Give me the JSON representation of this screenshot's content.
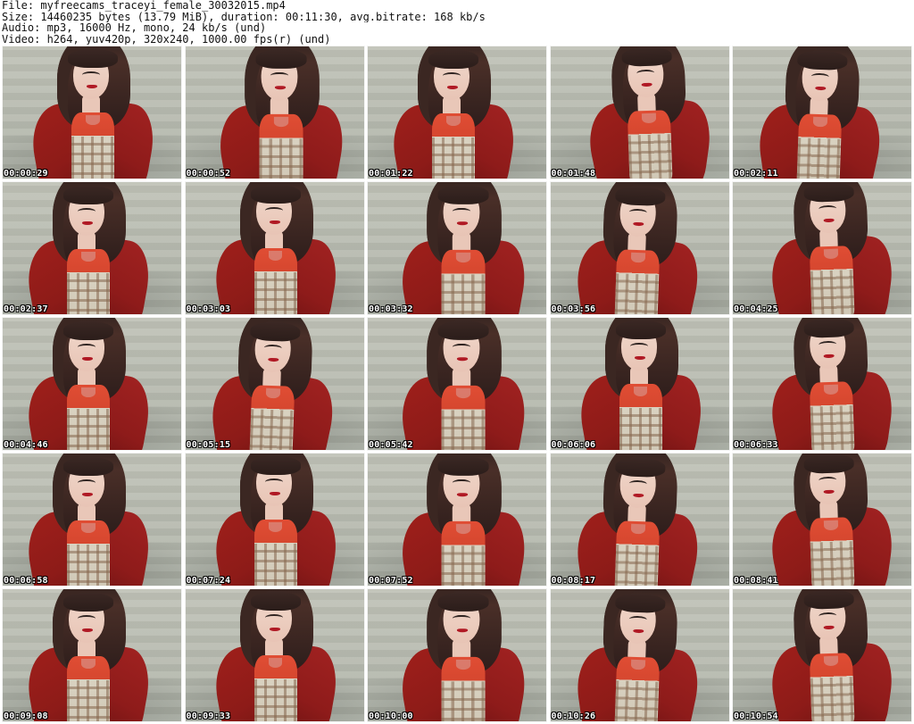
{
  "header": {
    "file": "File: myfreecams_traceyi_female_30032015.mp4",
    "size": "Size: 14460235 bytes (13.79 MiB), duration: 00:11:30, avg.bitrate: 168 kb/s",
    "audio": "Audio: mp3, 16000 Hz, mono, 24 kb/s (und)",
    "video": "Video: h264, yuv420p, 320x240, 1000.00 fps(r) (und)"
  },
  "thumbnails": [
    {
      "time": "00:00:29"
    },
    {
      "time": "00:00:52"
    },
    {
      "time": "00:01:22"
    },
    {
      "time": "00:01:48"
    },
    {
      "time": "00:02:11"
    },
    {
      "time": "00:02:37"
    },
    {
      "time": "00:03:03"
    },
    {
      "time": "00:03:32"
    },
    {
      "time": "00:03:56"
    },
    {
      "time": "00:04:25"
    },
    {
      "time": "00:04:46"
    },
    {
      "time": "00:05:15"
    },
    {
      "time": "00:05:42"
    },
    {
      "time": "00:06:06"
    },
    {
      "time": "00:06:33"
    },
    {
      "time": "00:06:58"
    },
    {
      "time": "00:07:24"
    },
    {
      "time": "00:07:52"
    },
    {
      "time": "00:08:17"
    },
    {
      "time": "00:08:41"
    },
    {
      "time": "00:09:08"
    },
    {
      "time": "00:09:33"
    },
    {
      "time": "00:10:00"
    },
    {
      "time": "00:10:26"
    },
    {
      "time": "00:10:54"
    }
  ]
}
